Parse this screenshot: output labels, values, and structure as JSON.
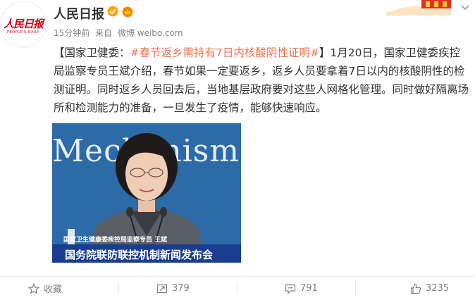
{
  "header": {
    "avatar_logo": "人民日报",
    "avatar_sub": "PEOPLE'S DAILY",
    "user_name": "人民日报",
    "time": "15分钟前",
    "source_prefix": "来自",
    "source": "微博 weibo.com"
  },
  "post": {
    "prefix": "【国家卫健委：",
    "topic": "#春节返乡需持有7日内核酸阴性证明#",
    "body": "】1月20日，国家卫健委疾控局监察专员王斌介绍，春节如果一定要返乡，返乡人员要拿着7日以内的核酸阴性的检测证明。同时返乡人员回去后，当地基层政府要对这些人网格化管理。同时做好隔离场所和检测能力的准备，一旦发生了疫情，能够快速响应。"
  },
  "media": {
    "backdrop_text": "Mechanism",
    "caption": "国家卫生健康委疾控局监察专员 王斌",
    "title": "国务院联防联控机制新闻发布会"
  },
  "actions": {
    "favorite_label": "收藏",
    "repost_count": "379",
    "comment_count": "791",
    "like_count": "3235"
  },
  "icons": {
    "verified": "verified-badge-icon",
    "crown": "crown-icon",
    "more": "chevron-down-icon",
    "favorite": "star-icon",
    "repost": "repost-icon",
    "comment": "comment-icon",
    "like": "thumbs-up-icon"
  },
  "colors": {
    "topic": "#eb7350",
    "verified": "#ffa500",
    "brand_red": "#d0021b",
    "meta_gray": "#808080"
  }
}
